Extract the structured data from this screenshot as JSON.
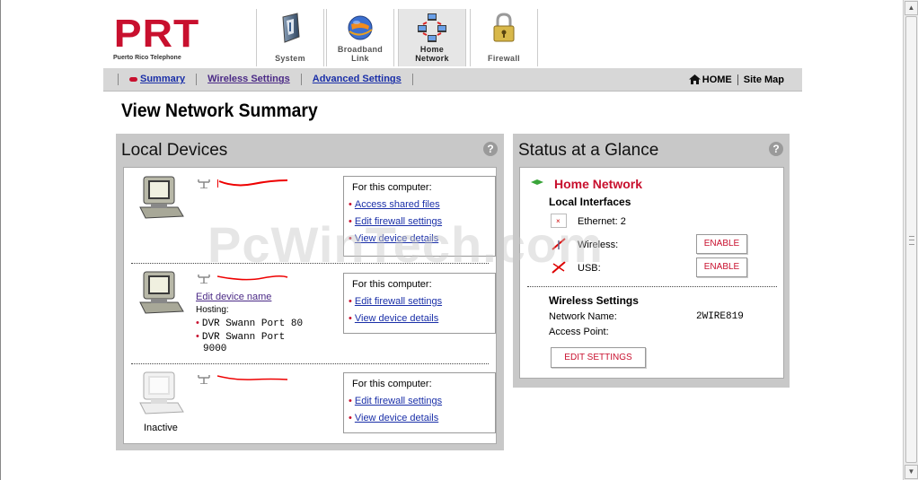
{
  "brand": {
    "logo_text": "PRT",
    "logo_subtitle": "Puerto Rico Telephone",
    "color": "#c8102e"
  },
  "tabs": [
    {
      "label_line1": "System",
      "label_line2": "",
      "icon": "system-icon",
      "active": false
    },
    {
      "label_line1": "Broadband",
      "label_line2": "Link",
      "icon": "globe-icon",
      "active": false
    },
    {
      "label_line1": "Home",
      "label_line2": "Network",
      "icon": "network-icon",
      "active": true
    },
    {
      "label_line1": "Firewall",
      "label_line2": "",
      "icon": "padlock-icon",
      "active": false
    }
  ],
  "nav": {
    "summary": "Summary",
    "wireless_settings": "Wireless Settings",
    "advanced_settings": "Advanced Settings",
    "home": "HOME",
    "site_map": "Site Map"
  },
  "page_title": "View Network Summary",
  "local_devices": {
    "title": "Local Devices",
    "help": "?",
    "actions_header": "For this computer:",
    "access_shared_files": "Access shared files",
    "edit_firewall_settings": "Edit firewall settings",
    "view_device_details": "View device details",
    "edit_device_name": "Edit device name",
    "hosting_label": "Hosting:",
    "hosting_items": [
      "DVR Swann Port 80",
      "DVR Swann Port",
      "9000"
    ],
    "inactive_label": "Inactive"
  },
  "status": {
    "title": "Status at a Glance",
    "help": "?",
    "home_network": "Home Network",
    "local_interfaces": "Local Interfaces",
    "ethernet_label": "Ethernet: 2",
    "wireless_label": "Wireless:",
    "usb_label": "USB:",
    "enable": "ENABLE",
    "wireless_settings": "Wireless Settings",
    "network_name_label": "Network Name:",
    "network_name_value": "2WIRE819",
    "access_point_label": "Access Point:",
    "edit_settings": "EDIT SETTINGS"
  },
  "watermark": "PcWinTech.com"
}
